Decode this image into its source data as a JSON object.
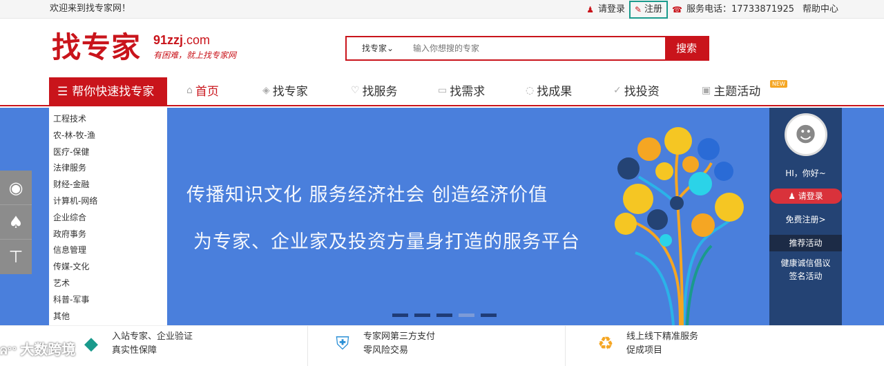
{
  "topbar": {
    "welcome": "欢迎来到找专家网！",
    "login": "请登录",
    "register": "注册",
    "phone": "服务电话：17733871925",
    "help": "帮助中心"
  },
  "logo": {
    "name": "找专家",
    "domain": "91zzj",
    "domain_suffix": ".com",
    "slogan": "有困难，就上找专家网"
  },
  "search": {
    "category": "找专家",
    "placeholder": "输入你想搜的专家",
    "button": "搜索"
  },
  "nav": {
    "main": "帮你快速找专家",
    "items": [
      {
        "label": "首页",
        "icon": "home-icon"
      },
      {
        "label": "找专家",
        "icon": "graduation-cap-icon"
      },
      {
        "label": "找服务",
        "icon": "heart-icon"
      },
      {
        "label": "找需求",
        "icon": "comment-icon"
      },
      {
        "label": "找成果",
        "icon": "chat-icon"
      },
      {
        "label": "找投资",
        "icon": "check-circle-icon"
      },
      {
        "label": "主题活动",
        "icon": "gift-icon"
      }
    ],
    "new_badge": "NEW"
  },
  "categories": [
    "工程技术",
    "农-林-牧-渔",
    "医疗-保健",
    "法律服务",
    "财经-金融",
    "计算机-网络",
    "企业综合",
    "政府事务",
    "信息管理",
    "传媒-文化",
    "艺术",
    "科普-军事",
    "其他"
  ],
  "hero": {
    "line1": "传播知识文化  服务经济社会  创造经济价值",
    "line2": "为专家、企业家及投资方量身打造的服务平台",
    "active_slide": 4,
    "slides": 5
  },
  "right_panel": {
    "greeting": "HI，你好~",
    "login": "请登录",
    "register": "免费注册>",
    "recommend": "推荐活动",
    "activity_line1": "健康诚信倡议",
    "activity_line2": "签名活动"
  },
  "features": [
    {
      "line1": "入站专家、企业验证",
      "line2": "真实性保障",
      "icon": "verify-icon"
    },
    {
      "line1": "专家网第三方支付",
      "line2": "零风险交易",
      "icon": "shield-icon"
    },
    {
      "line1": "线上线下精准服务",
      "line2": "促成项目",
      "icon": "recycle-icon"
    }
  ],
  "watermark": "大数跨境",
  "colors": {
    "brand": "#c9141b",
    "hero": "#4a7fdc",
    "panel": "#244374"
  }
}
